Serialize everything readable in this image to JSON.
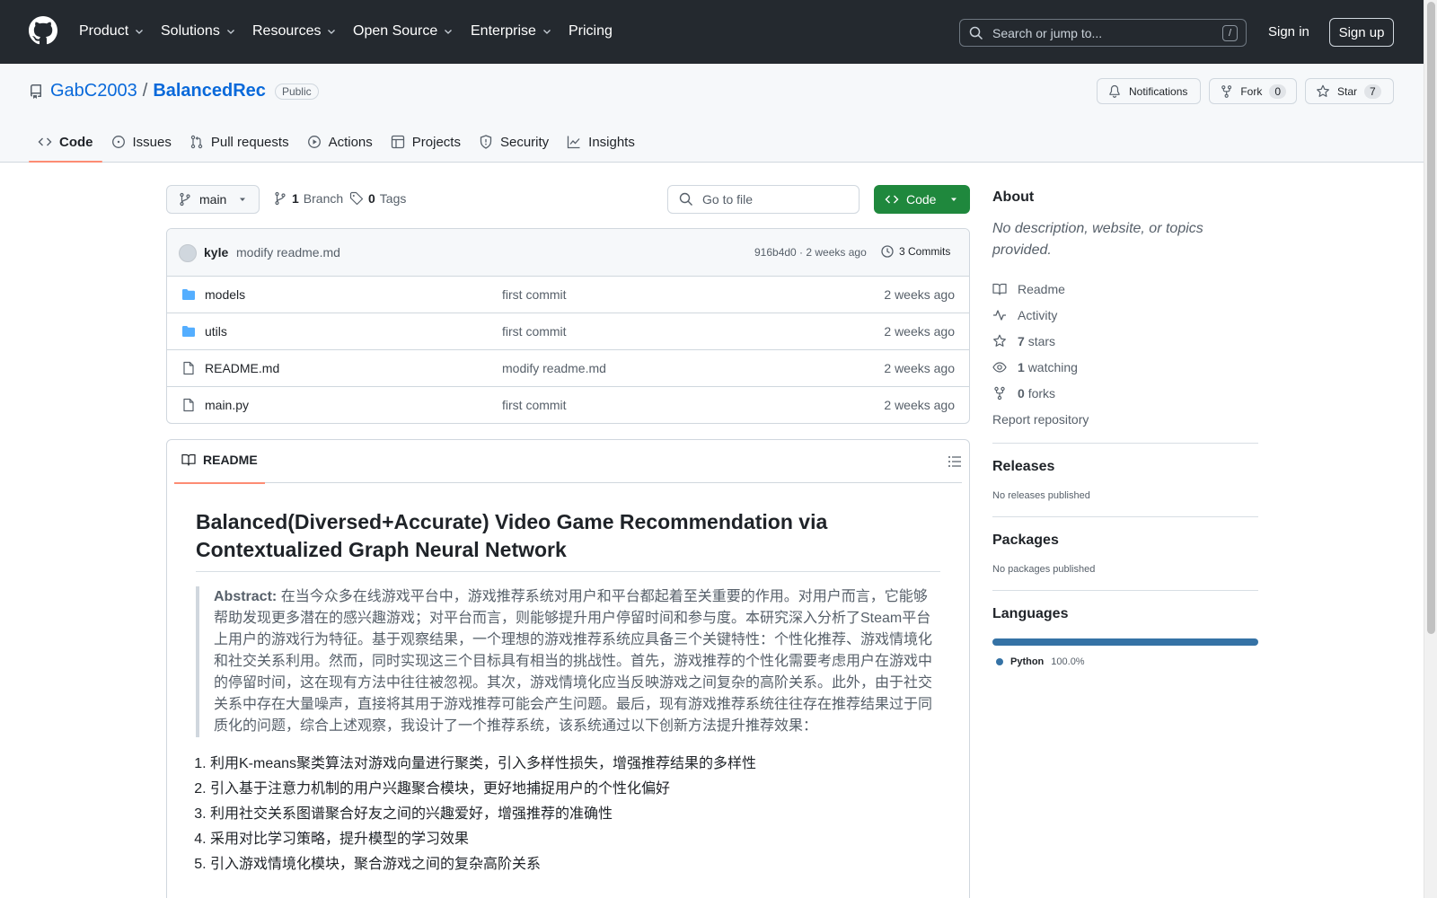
{
  "header": {
    "nav": [
      "Product",
      "Solutions",
      "Resources",
      "Open Source",
      "Enterprise",
      "Pricing"
    ],
    "search_placeholder": "Search or jump to...",
    "search_shortcut": "/",
    "signin": "Sign in",
    "signup": "Sign up"
  },
  "repo": {
    "owner": "GabC2003",
    "separator": "/",
    "name": "BalancedRec",
    "visibility": "Public",
    "notifications_label": "Notifications",
    "fork_label": "Fork",
    "fork_count": "0",
    "star_label": "Star",
    "star_count": "7"
  },
  "tabs": [
    {
      "label": "Code",
      "icon": "code-icon"
    },
    {
      "label": "Issues",
      "icon": "issue-icon"
    },
    {
      "label": "Pull requests",
      "icon": "pull-request-icon"
    },
    {
      "label": "Actions",
      "icon": "play-icon"
    },
    {
      "label": "Projects",
      "icon": "table-icon"
    },
    {
      "label": "Security",
      "icon": "shield-icon"
    },
    {
      "label": "Insights",
      "icon": "graph-icon"
    }
  ],
  "browser": {
    "branch": "main",
    "branch_count": "1",
    "branch_label": "Branch",
    "tag_count": "0",
    "tag_label": "Tags",
    "goto_placeholder": "Go to file",
    "code_button": "Code",
    "commit": {
      "author": "kyle",
      "message": "modify readme.md",
      "sha": "916b4d0",
      "time": "2 weeks ago",
      "sha_time": "916b4d0 · 2 weeks ago",
      "commits": "3 Commits"
    },
    "files": [
      {
        "name": "models",
        "type": "folder",
        "message": "first commit",
        "date": "2 weeks ago"
      },
      {
        "name": "utils",
        "type": "folder",
        "message": "first commit",
        "date": "2 weeks ago"
      },
      {
        "name": "README.md",
        "type": "file",
        "message": "modify readme.md",
        "date": "2 weeks ago"
      },
      {
        "name": "main.py",
        "type": "file",
        "message": "first commit",
        "date": "2 weeks ago"
      }
    ]
  },
  "readme": {
    "tab_label": "README",
    "title": "Balanced(Diversed+Accurate) Video Game Recommendation via Contextualized Graph Neural Network",
    "abstract_label": "Abstract:",
    "abstract_text": "在当今众多在线游戏平台中，游戏推荐系统对用户和平台都起着至关重要的作用。对用户而言，它能够帮助发现更多潜在的感兴趣游戏；对平台而言，则能够提升用户停留时间和参与度。本研究深入分析了Steam平台上用户的游戏行为特征。基于观察结果，一个理想的游戏推荐系统应具备三个关键特性：个性化推荐、游戏情境化和社交关系利用。然而，同时实现这三个目标具有相当的挑战性。首先，游戏推荐的个性化需要考虑用户在游戏中的停留时间，这在现有方法中往往被忽视。其次，游戏情境化应当反映游戏之间复杂的高阶关系。此外，由于社交关系中存在大量噪声，直接将其用于游戏推荐可能会产生问题。最后，现有游戏推荐系统往往存在推荐结果过于同质化的问题，综合上述观察，我设计了一个推荐系统，该系统通过以下创新方法提升推荐效果：",
    "list": [
      "利用K-means聚类算法对游戏向量进行聚类，引入多样性损失，增强推荐结果的多样性",
      "引入基于注意力机制的用户兴趣聚合模块，更好地捕捉用户的个性化偏好",
      "利用社交关系图谱聚合好友之间的兴趣爱好，增强推荐的准确性",
      "采用对比学习策略，提升模型的学习效果",
      "引入游戏情境化模块，聚合游戏之间的复杂高阶关系"
    ]
  },
  "sidebar": {
    "about_title": "About",
    "about_desc": "No description, website, or topics provided.",
    "links": [
      {
        "icon": "book-icon",
        "bold": "",
        "text": "Readme"
      },
      {
        "icon": "pulse-icon",
        "bold": "",
        "text": "Activity"
      },
      {
        "icon": "star-icon",
        "bold": "7",
        "text": "stars"
      },
      {
        "icon": "eye-icon",
        "bold": "1",
        "text": "watching"
      },
      {
        "icon": "fork-icon",
        "bold": "0",
        "text": "forks"
      }
    ],
    "report": "Report repository",
    "releases_title": "Releases",
    "releases_desc": "No releases published",
    "packages_title": "Packages",
    "packages_desc": "No packages published",
    "languages_title": "Languages",
    "language": {
      "name": "Python",
      "percent": "100.0%",
      "color": "#3572a5"
    }
  },
  "colors": {
    "header_bg": "#24292f",
    "link": "#0969da",
    "code_button": "#1f883d",
    "active_tab_underline": "#fd8c73",
    "folder": "#54aeff"
  }
}
